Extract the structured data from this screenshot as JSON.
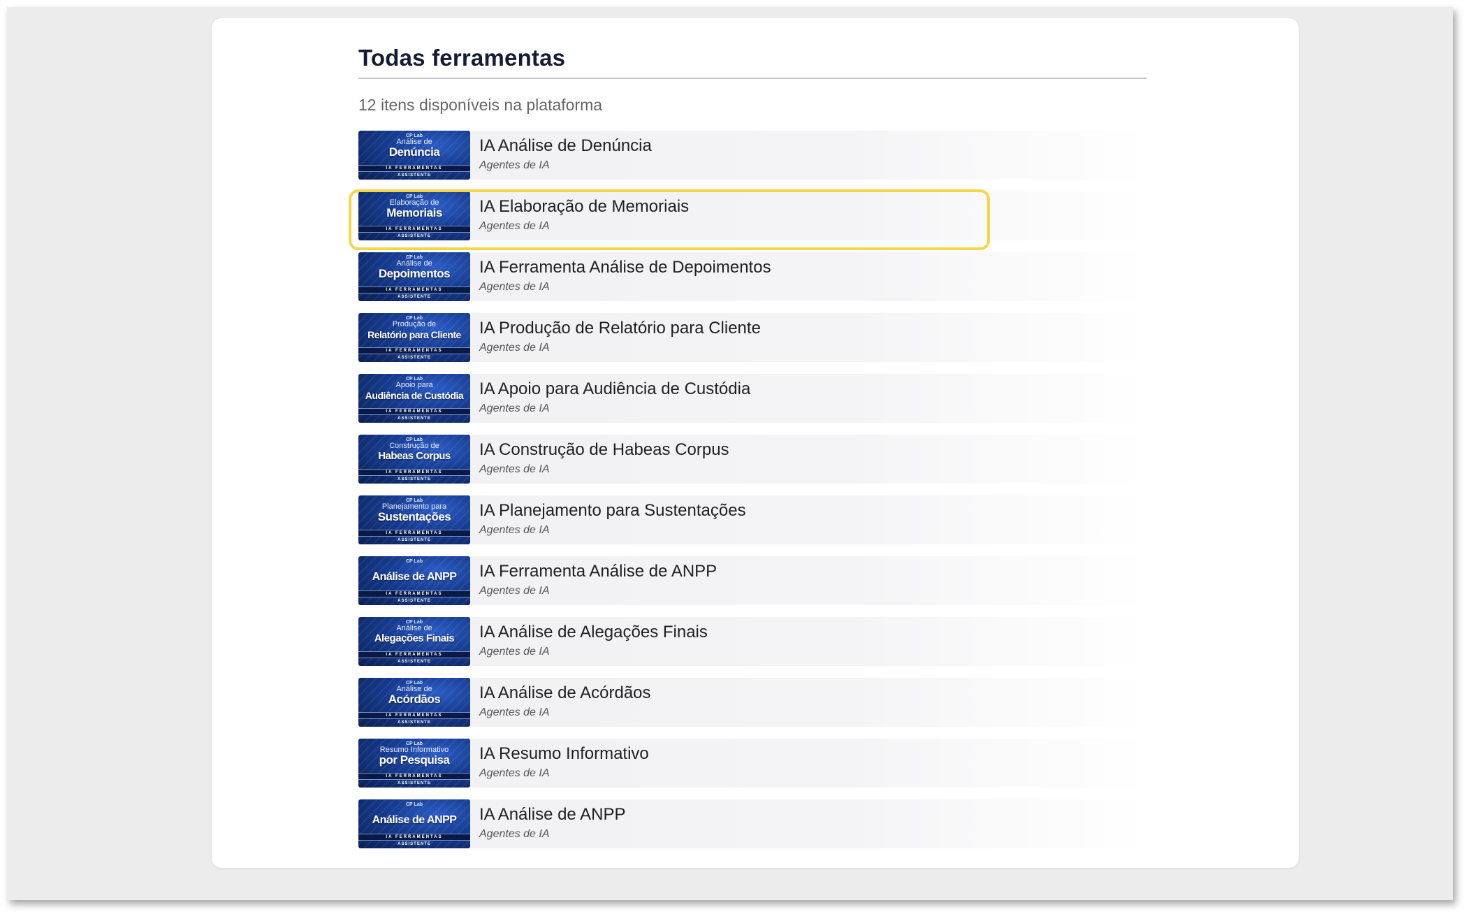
{
  "page": {
    "title": "Todas ferramentas",
    "subtitle": "12 itens disponíveis na plataforma"
  },
  "thumbnail": {
    "brand": "CP Lab",
    "band_text": "IA FERRAMENTAS",
    "footer_text": "ASSISTENTE"
  },
  "highlighted_item_index": 1,
  "colors": {
    "title": "#141b33",
    "highlight_border": "#f5d64a",
    "thumbnail_blue": "#163b8f"
  },
  "items": [
    {
      "name": "IA Análise de Denúncia",
      "category": "Agentes de IA",
      "thumb_top": "Análise de",
      "thumb_main": "Denúncia"
    },
    {
      "name": "IA Elaboração de Memoriais",
      "category": "Agentes de IA",
      "thumb_top": "Elaboração de",
      "thumb_main": "Memoriais"
    },
    {
      "name": "IA Ferramenta Análise de Depoimentos",
      "category": "Agentes de IA",
      "thumb_top": "Análise de",
      "thumb_main": "Depoimentos"
    },
    {
      "name": "IA Produção de Relatório para Cliente",
      "category": "Agentes de IA",
      "thumb_top": "Produção de",
      "thumb_main": "Relatório para Cliente"
    },
    {
      "name": "IA Apoio para Audiência de Custódia",
      "category": "Agentes de IA",
      "thumb_top": "Apoio para",
      "thumb_main": "Audiência de Custódia"
    },
    {
      "name": "IA Construção de Habeas Corpus",
      "category": "Agentes de IA",
      "thumb_top": "Construção de",
      "thumb_main": "Habeas Corpus"
    },
    {
      "name": "IA Planejamento para Sustentações",
      "category": "Agentes de IA",
      "thumb_top": "Planejamento para",
      "thumb_main": "Sustentações"
    },
    {
      "name": "IA Ferramenta Análise de ANPP",
      "category": "Agentes de IA",
      "thumb_top": "",
      "thumb_main": "Análise de ANPP"
    },
    {
      "name": "IA Análise de Alegações Finais",
      "category": "Agentes de IA",
      "thumb_top": "Análise de",
      "thumb_main": "Alegações Finais"
    },
    {
      "name": "IA Análise de Acórdãos",
      "category": "Agentes de IA",
      "thumb_top": "Análise de",
      "thumb_main": "Acórdãos"
    },
    {
      "name": "IA Resumo Informativo",
      "category": "Agentes de IA",
      "thumb_top": "Resumo Informativo",
      "thumb_main": "por Pesquisa"
    },
    {
      "name": "IA Análise de ANPP",
      "category": "Agentes de IA",
      "thumb_top": "",
      "thumb_main": "Análise de ANPP"
    }
  ]
}
